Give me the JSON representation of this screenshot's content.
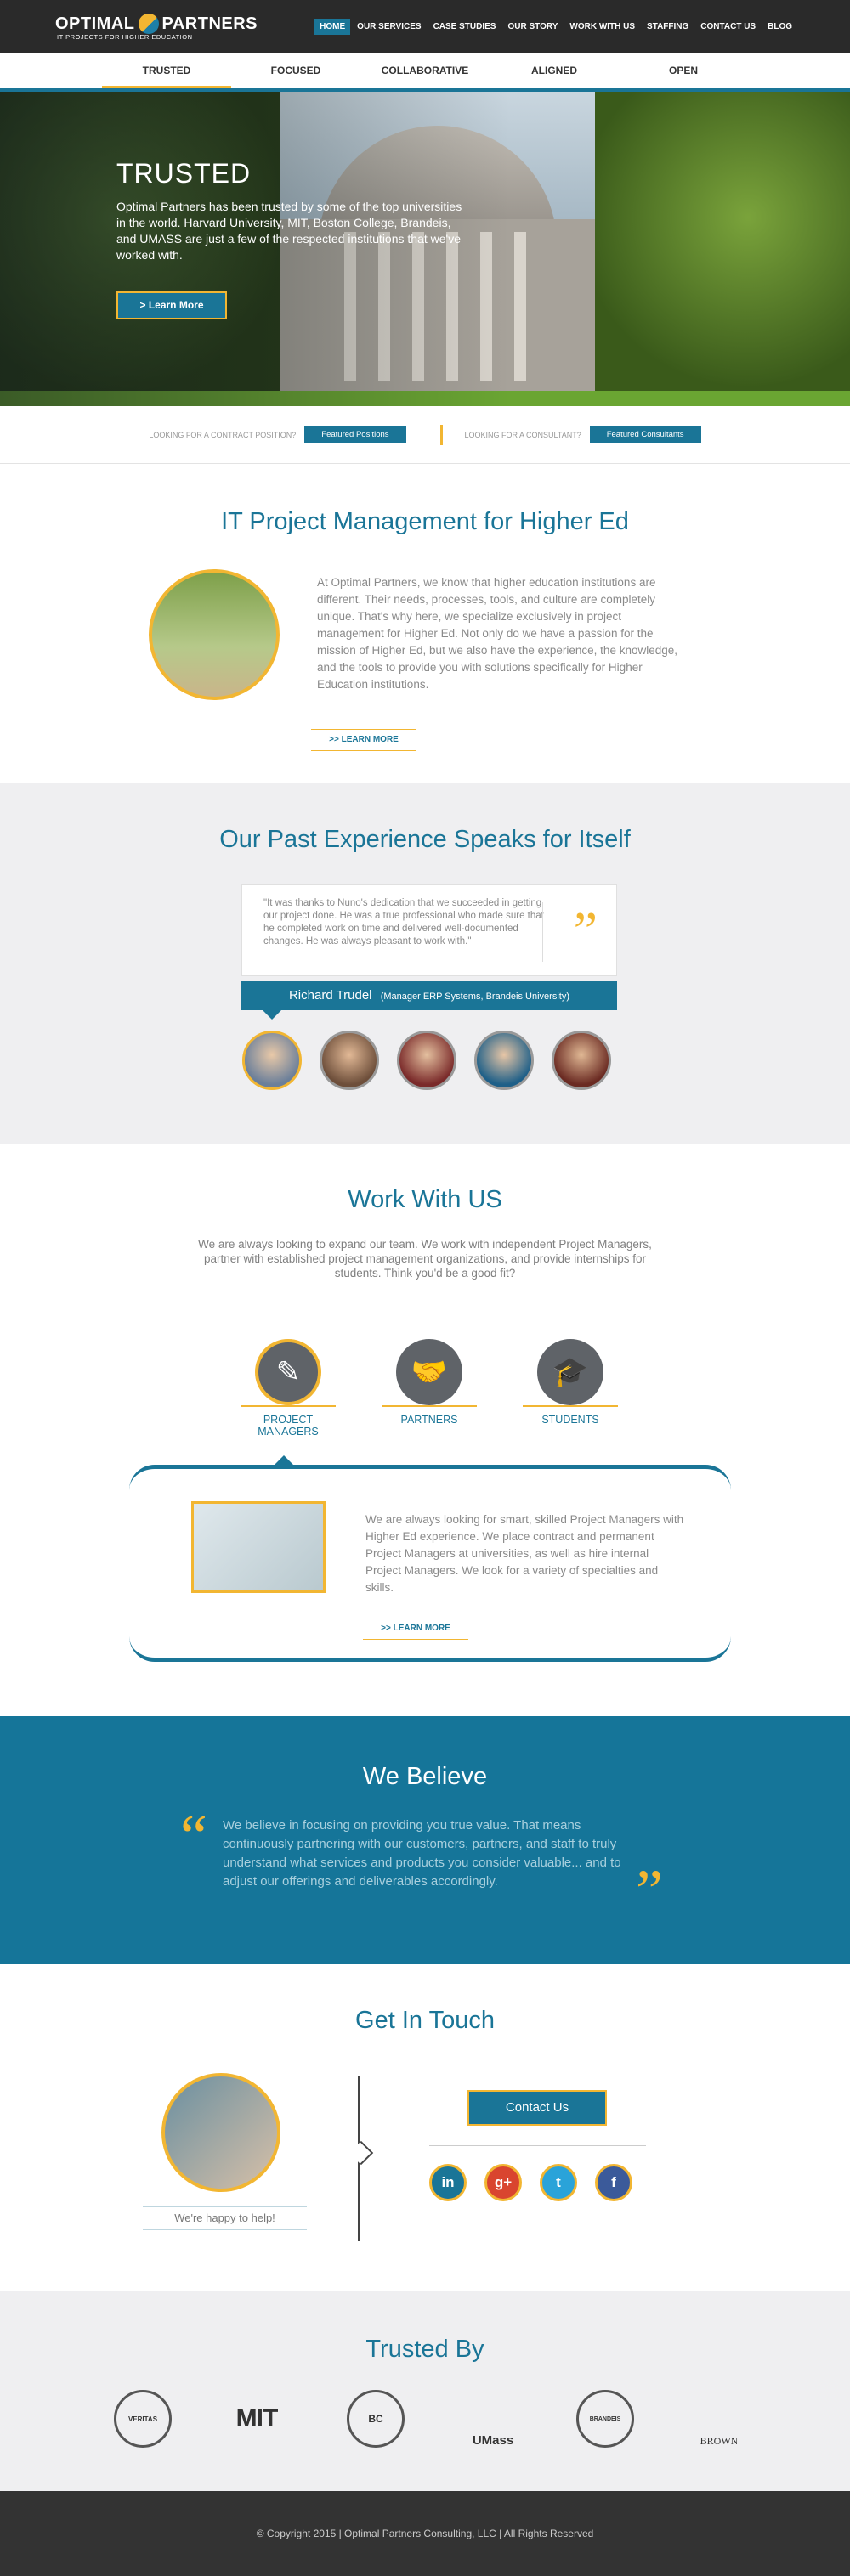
{
  "header": {
    "logo_left": "OPTIMAL",
    "logo_right": "PARTNERS",
    "tagline": "IT PROJECTS FOR HIGHER EDUCATION",
    "nav": [
      "HOME",
      "OUR SERVICES",
      "CASE STUDIES",
      "OUR STORY",
      "WORK WITH US",
      "STAFFING",
      "CONTACT US",
      "BLOG"
    ]
  },
  "tabs": [
    "TRUSTED",
    "FOCUSED",
    "COLLABORATIVE",
    "ALIGNED",
    "OPEN"
  ],
  "hero": {
    "title": "TRUSTED",
    "text": "Optimal Partners has been trusted by some of the top universities in the world. Harvard University, MIT, Boston College, Brandeis, and UMASS are just a few of the respected institutions that we've worked with.",
    "button": ">  Learn More"
  },
  "look": {
    "contract_label": "LOOKING FOR A CONTRACT POSITION?",
    "contract_btn": "Featured Positions",
    "consultant_label": "LOOKING FOR A CONSULTANT?",
    "consultant_btn": "Featured Consultants"
  },
  "itpm": {
    "title": "IT Project Management for Higher Ed",
    "text": "At Optimal Partners, we know that higher education institutions are different. Their needs, processes, tools, and culture are completely unique. That's why here, we specialize exclusively in project management for Higher Ed. Not only do we have a passion for the mission of Higher Ed, but we also have the experience, the knowledge, and the tools to provide you with solutions specifically for Higher Education institutions.",
    "learn": ">>  LEARN MORE"
  },
  "experience": {
    "title": "Our Past Experience Speaks for Itself",
    "quote": "\"It was thanks to Nuno's dedication that we succeeded in getting our project done. He was a true professional who made sure that he completed work on time and delivered well-documented changes. He was always pleasant to work with.\"",
    "name": "Richard Trudel",
    "role": "(Manager ERP Systems, Brandeis University)"
  },
  "work": {
    "title": "Work With US",
    "intro": "We are always looking to expand our team. We work with independent Project Managers, partner with established project management organizations, and provide internships for students. Think you'd be a good fit?",
    "options": [
      "PROJECT MANAGERS",
      "PARTNERS",
      "STUDENTS"
    ],
    "text": "We are always looking for smart, skilled Project Managers with Higher Ed experience. We place contract and permanent Project Managers at universities, as well as hire internal Project Managers. We look for a variety of specialties and skills.",
    "learn": ">>  LEARN MORE"
  },
  "believe": {
    "title": "We Believe",
    "text": "We believe in focusing on providing you true value. That means continuously partnering with our customers, partners, and staff to truly understand what services and products you consider valuable... and to adjust our offerings and deliverables accordingly."
  },
  "touch": {
    "title": "Get In Touch",
    "happy": "We're happy to help!",
    "button": "Contact Us",
    "social": [
      "in",
      "g+",
      "t",
      "f"
    ]
  },
  "trusted": {
    "title": "Trusted By",
    "logos": [
      "VERITAS",
      "MIT",
      "BC",
      "UMass",
      "BRANDEIS",
      "BROWN"
    ]
  },
  "footer": "© Copyright 2015 | Optimal Partners Consulting, LLC | All Rights Reserved"
}
